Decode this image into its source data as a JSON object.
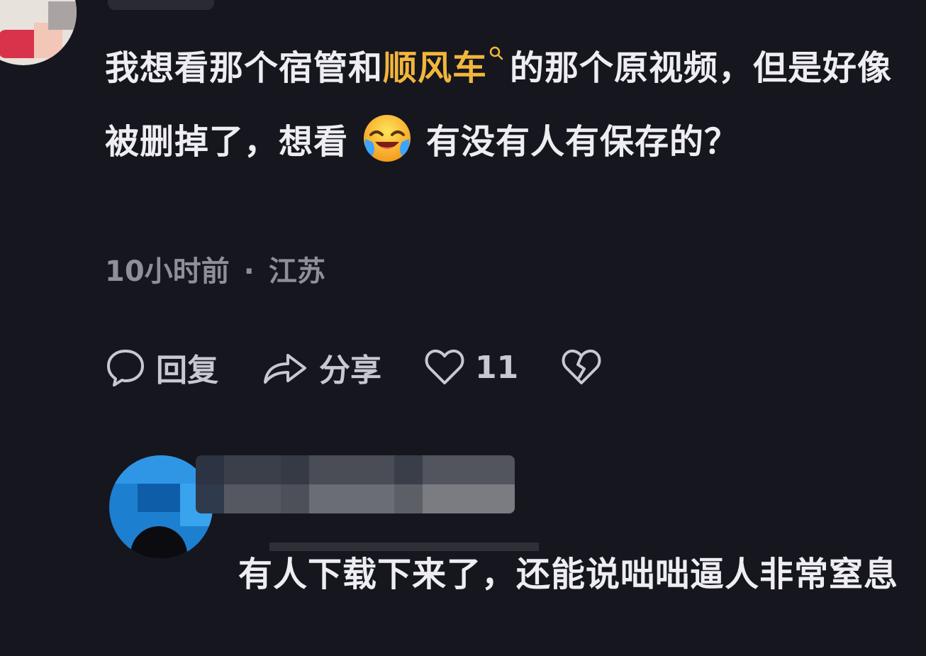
{
  "comment": {
    "text_before": "我想看那个宿管和",
    "keyword": "顺风车",
    "text_after_keyword": "的那个原视频，但是好像被删掉了，想看",
    "text_end": "有没有人有保存的？",
    "emoji": "crying-laughing-emoji",
    "keyword_color": "#f2b63c"
  },
  "meta": {
    "time": "10小时前",
    "separator": "·",
    "location": "江苏"
  },
  "actions": {
    "reply_label": "回复",
    "share_label": "分享",
    "like_count": "11"
  },
  "reply": {
    "text": "有人下载下来了，还能说咄咄逼人非常窒息"
  },
  "icons": {
    "reply": "speech-bubble-icon",
    "share": "share-arrow-icon",
    "like": "heart-icon",
    "dislike": "broken-heart-icon",
    "search": "search-icon"
  }
}
